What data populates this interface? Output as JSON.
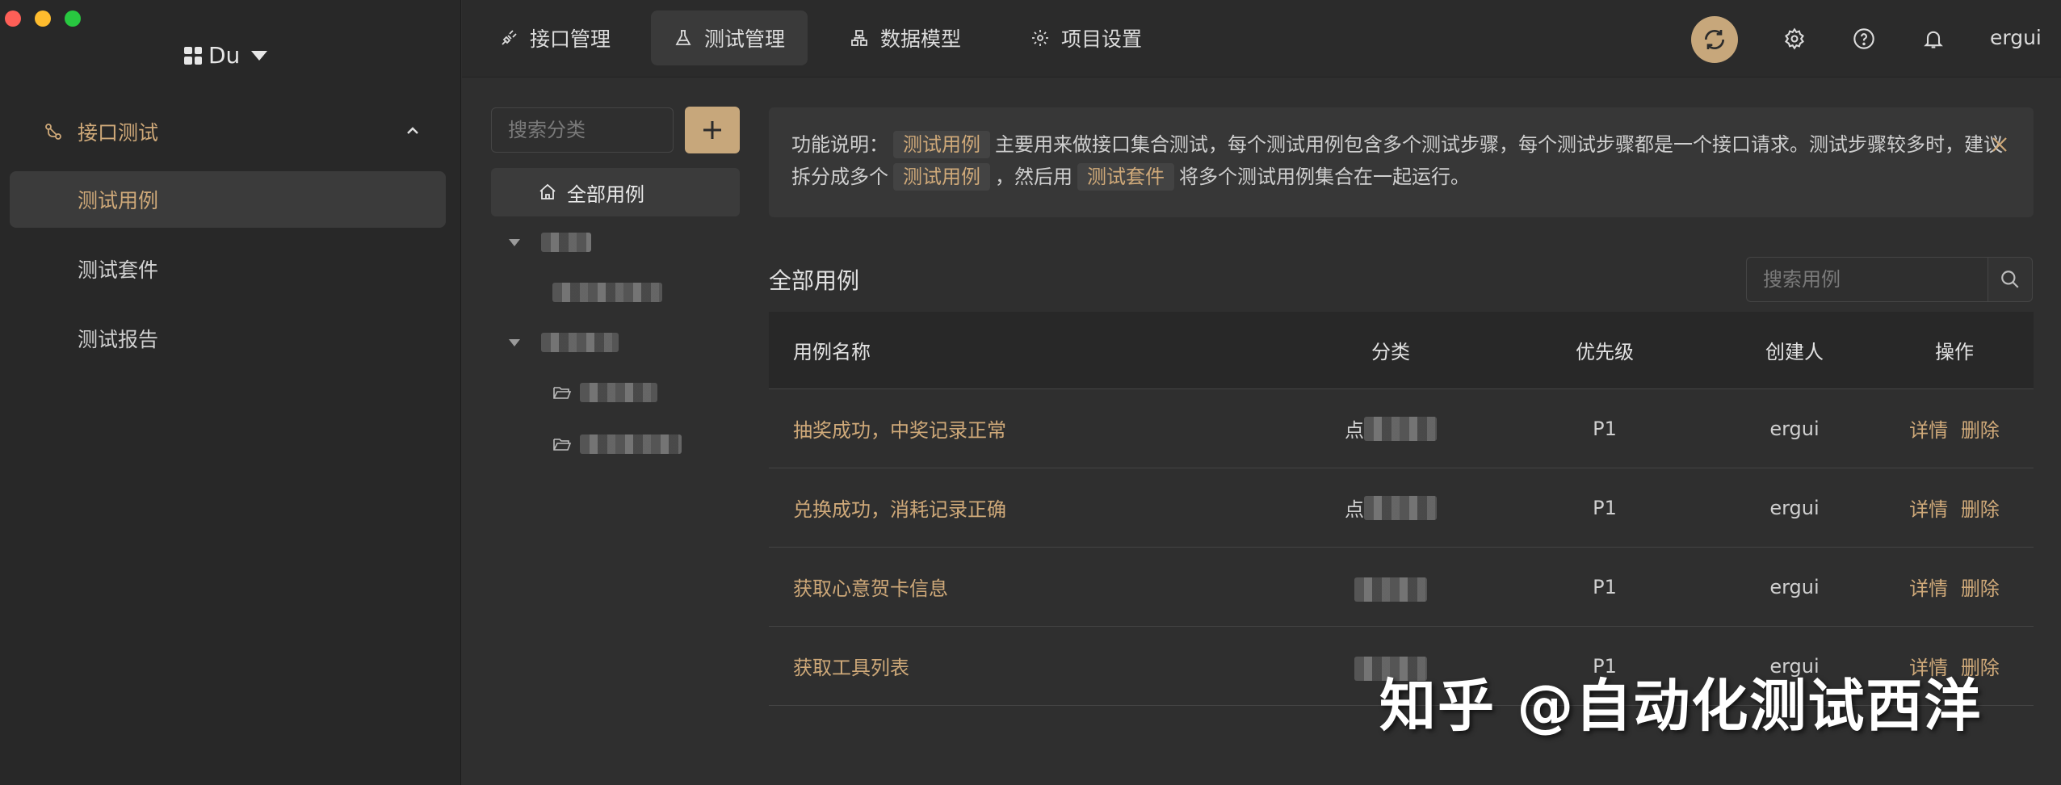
{
  "app": {
    "brand": "Du",
    "username": "ergui",
    "accent": "#c7a77b"
  },
  "sidebar": {
    "group_label": "接口测试",
    "items": [
      {
        "label": "测试用例",
        "active": true
      },
      {
        "label": "测试套件",
        "active": false
      },
      {
        "label": "测试报告",
        "active": false
      }
    ]
  },
  "topnav": {
    "tabs": [
      {
        "label": "接口管理",
        "icon": "plug-icon",
        "active": false
      },
      {
        "label": "测试管理",
        "icon": "flask-icon",
        "active": true
      },
      {
        "label": "数据模型",
        "icon": "model-icon",
        "active": false
      },
      {
        "label": "项目设置",
        "icon": "gear-icon",
        "active": false
      }
    ]
  },
  "categories": {
    "search_placeholder": "搜索分类",
    "all_label": "全部用例"
  },
  "banner": {
    "prefix": "功能说明：",
    "tag1": "测试用例",
    "text1": "主要用来做接口集合测试，每个测试用例包含多个测试步骤，每个测试步骤都是一个接口请求。测试步骤较多时，建议拆分成多个",
    "tag2": "测试用例",
    "text2": "，然后用",
    "tag3": "测试套件",
    "text3": "将多个测试用例集合在一起运行。"
  },
  "cases": {
    "section_title": "全部用例",
    "search_placeholder": "搜索用例",
    "columns": [
      "用例名称",
      "分类",
      "优先级",
      "创建人",
      "操作"
    ],
    "rows": [
      {
        "name": "抽奖成功，中奖记录正常",
        "category_prefix": "点",
        "priority": "P1",
        "creator": "ergui",
        "detail": "详情",
        "delete": "删除"
      },
      {
        "name": "兑换成功，消耗记录正确",
        "category_prefix": "点",
        "priority": "P1",
        "creator": "ergui",
        "detail": "详情",
        "delete": "删除"
      },
      {
        "name": "获取心意贺卡信息",
        "category_prefix": "",
        "priority": "P1",
        "creator": "ergui",
        "detail": "详情",
        "delete": "删除"
      },
      {
        "name": "获取工具列表",
        "category_prefix": "",
        "priority": "P1",
        "creator": "ergui",
        "detail": "详情",
        "delete": "删除"
      }
    ]
  },
  "watermark": "知乎 @自动化测试西洋"
}
